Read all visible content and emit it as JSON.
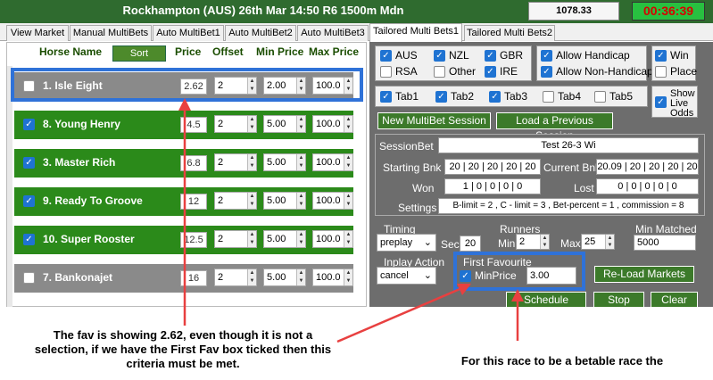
{
  "titlebar": {
    "market": "Rockhampton (AUS) 26th Mar 14:50 R6 1500m Mdn",
    "balance": "1078.33",
    "timer": "00:36:39"
  },
  "tabs": [
    {
      "label": "View Market",
      "active": false
    },
    {
      "label": "Manual MultiBets",
      "active": false
    },
    {
      "label": "Auto MultiBet1",
      "active": false
    },
    {
      "label": "Auto MultiBet2",
      "active": false
    },
    {
      "label": "Auto MultiBet3",
      "active": false
    },
    {
      "label": "Tailored Multi Bets1",
      "active": true
    },
    {
      "label": "Tailored Multi Bets2",
      "active": false
    }
  ],
  "grid_header": {
    "horse_name": "Horse Name",
    "sort": "Sort",
    "price": "Price",
    "offset": "Offset",
    "min_price": "Min Price",
    "max_price": "Max Price"
  },
  "horses": [
    {
      "name": "1. Isle Eight",
      "price": "2.62",
      "offset": "2",
      "min": "2.00",
      "max": "100.0",
      "checked": false,
      "color": "grey"
    },
    {
      "name": "8. Young Henry",
      "price": "4.5",
      "offset": "2",
      "min": "5.00",
      "max": "100.0",
      "checked": true,
      "color": "green"
    },
    {
      "name": "3. Master Rich",
      "price": "6.8",
      "offset": "2",
      "min": "5.00",
      "max": "100.0",
      "checked": true,
      "color": "green"
    },
    {
      "name": "9. Ready To Groove",
      "price": "12",
      "offset": "2",
      "min": "5.00",
      "max": "100.0",
      "checked": true,
      "color": "green"
    },
    {
      "name": "10. Super Rooster",
      "price": "12.5",
      "offset": "2",
      "min": "5.00",
      "max": "100.0",
      "checked": true,
      "color": "green"
    },
    {
      "name": "7. Bankonajet",
      "price": "16",
      "offset": "2",
      "min": "5.00",
      "max": "100.0",
      "checked": false,
      "color": "grey"
    }
  ],
  "countries": [
    {
      "label": "AUS",
      "checked": true
    },
    {
      "label": "NZL",
      "checked": true
    },
    {
      "label": "GBR",
      "checked": true
    },
    {
      "label": "RSA",
      "checked": false
    },
    {
      "label": "Other",
      "checked": false
    },
    {
      "label": "IRE",
      "checked": true
    }
  ],
  "handicap": [
    {
      "label": "Allow Handicap",
      "checked": true
    },
    {
      "label": "Allow Non-Handicap",
      "checked": true
    }
  ],
  "bet_type": [
    {
      "label": "Win",
      "checked": true
    },
    {
      "label": "Place",
      "checked": false
    }
  ],
  "tab_selectors": [
    {
      "label": "Tab1",
      "checked": true
    },
    {
      "label": "Tab2",
      "checked": true
    },
    {
      "label": "Tab3",
      "checked": true
    },
    {
      "label": "Tab4",
      "checked": false
    },
    {
      "label": "Tab5",
      "checked": false
    }
  ],
  "show_live_odds": {
    "label": "Show Live Odds",
    "checked": true
  },
  "buttons": {
    "new_session": "New MultiBet Session",
    "load_session": "Load a Previous Session",
    "reload": "Re-Load Markets",
    "schedule": "Schedule",
    "stop": "Stop",
    "clear": "Clear"
  },
  "session": {
    "session_label": "SessionBet",
    "session_value": "Test 26-3 Wi",
    "starting_label": "Starting Bnk",
    "starting_value": "20 | 20 | 20 | 20 | 20",
    "current_label": "Current Bnk",
    "current_value": "20.09 | 20 | 20 | 20 | 20",
    "won_label": "Won",
    "won_value": "1 | 0 | 0 | 0 | 0",
    "lost_label": "Lost",
    "lost_value": "0 | 0 | 0 | 0 | 0",
    "settings_label": "Settings",
    "settings_value": "B-limit = 2 , C - limit = 3 , Bet-percent = 1 , commission = 8"
  },
  "timing": {
    "label": "Timing",
    "value": "preplay",
    "sec_label": "Sec",
    "sec_value": "20"
  },
  "runners": {
    "label": "Runners",
    "min_label": "Min",
    "min_value": "2",
    "max_label": "Max",
    "max_value": "25"
  },
  "min_matched": {
    "label": "Min Matched",
    "value": "5000"
  },
  "inplay": {
    "label": "Inplay Action",
    "value": "cancel"
  },
  "first_fav": {
    "label": "First Favourite",
    "minprice_label": "MinPrice",
    "minprice_value": "3.00",
    "checked": true
  },
  "annotations": {
    "left": "The fav is showing 2.62, even though it is not a selection, if we have the First Fav box ticked then this criteria must be met.",
    "right": "For this race to be a betable race the"
  },
  "colors": {
    "accent_blue": "#2f72d8",
    "arrow_red": "#e84040",
    "row_green": "#2b8a1a"
  }
}
